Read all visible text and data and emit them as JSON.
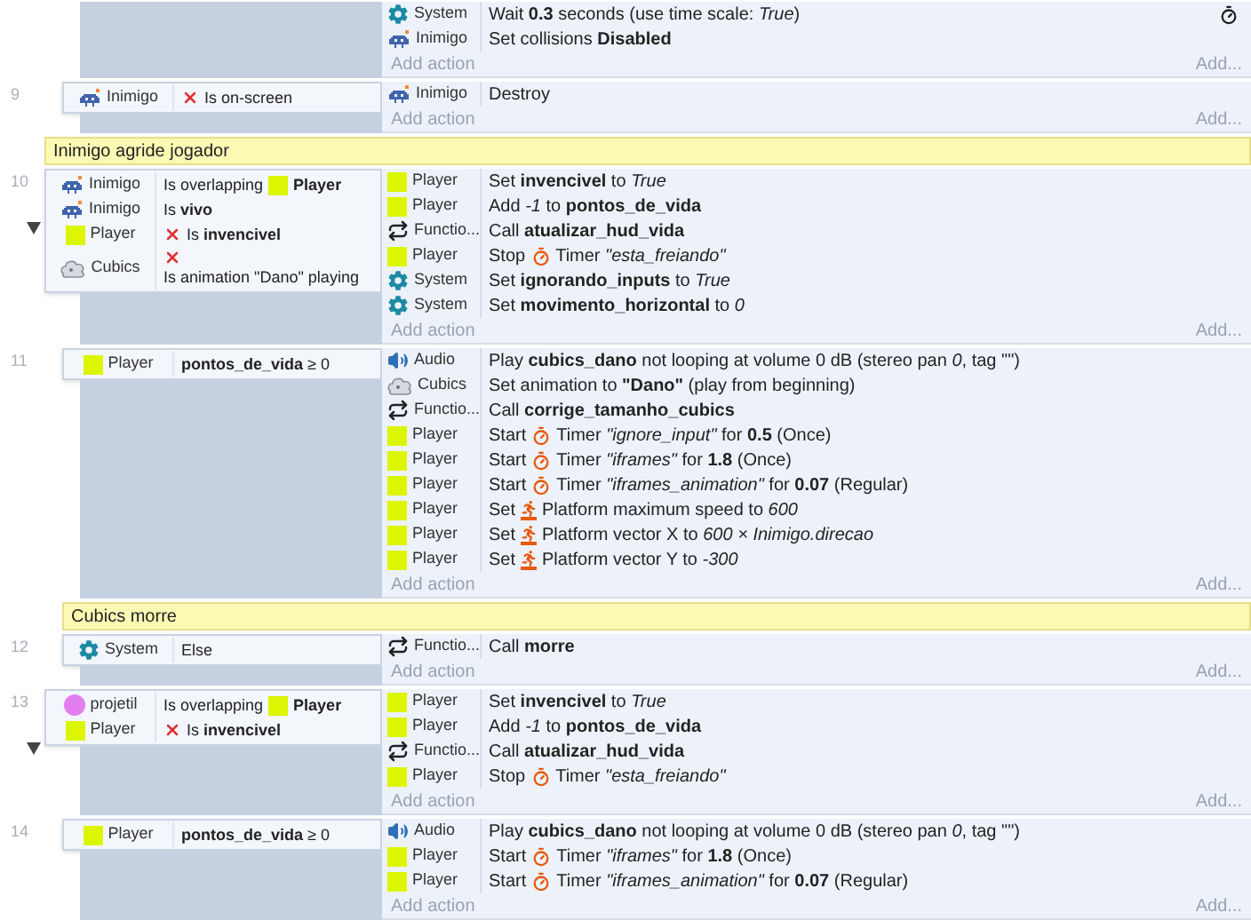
{
  "events": [
    {
      "kind": "event",
      "children": [
        {
          "kind": "event",
          "timer": true,
          "actions": [
            {
              "kind": "plain",
              "object": {
                "name": "System",
                "kind": "system"
              },
              "text": "Wait **0.3** seconds (use time scale: *True*)"
            },
            {
              "kind": "plain",
              "object": {
                "name": "Inimigo",
                "kind": "enemy"
              },
              "text": "Set collisions **Disabled**"
            }
          ],
          "add_action": "Add action",
          "add": "Add..."
        },
        {
          "kind": "event",
          "number": "9",
          "conditions": [
            {
              "object": {
                "name": "Inimigo",
                "kind": "enemy"
              },
              "inverted": true,
              "text": "Is on-screen"
            }
          ],
          "actions": [
            {
              "kind": "plain",
              "object": {
                "name": "Inimigo",
                "kind": "enemy"
              },
              "text": "Destroy"
            }
          ],
          "add_action": "Add action",
          "add": "Add..."
        }
      ]
    },
    {
      "kind": "comment",
      "text": "Inimigo agride jogador"
    },
    {
      "kind": "event",
      "number": "10",
      "expanded": true,
      "conditions": [
        {
          "object": {
            "name": "Inimigo",
            "kind": "enemy"
          },
          "inverted": false,
          "text": "Is overlapping",
          "target": {
            "name": "Player",
            "kind": "sprite"
          }
        },
        {
          "object": {
            "name": "Inimigo",
            "kind": "enemy"
          },
          "inverted": false,
          "text": "Is **vivo**"
        },
        {
          "object": {
            "name": "Player",
            "kind": "sprite"
          },
          "inverted": true,
          "text": "Is **invencivel**"
        },
        {
          "object": {
            "name": "Cubics",
            "kind": "cubics"
          },
          "inverted": true,
          "text": "Is animation \"Dano\" playing"
        }
      ],
      "actions": [
        {
          "kind": "plain",
          "object": {
            "name": "Player",
            "kind": "sprite"
          },
          "text": "Set **invencivel** to *True*"
        },
        {
          "kind": "plain",
          "object": {
            "name": "Player",
            "kind": "sprite"
          },
          "text": "Add *-1* to **pontos_de_vida**"
        },
        {
          "kind": "plain",
          "object": {
            "name": "Functio...",
            "kind": "function"
          },
          "text": "Call **atualizar_hud_vida**"
        },
        {
          "kind": "timer",
          "object": {
            "name": "Player",
            "kind": "sprite"
          },
          "verb": "Stop",
          "text": "Timer *\"esta_freiando\"*"
        },
        {
          "kind": "plain",
          "object": {
            "name": "System",
            "kind": "system"
          },
          "text": "Set **ignorando_inputs** to *True*"
        },
        {
          "kind": "plain",
          "object": {
            "name": "System",
            "kind": "system"
          },
          "text": "Set **movimento_horizontal** to *0*"
        }
      ],
      "add_action": "Add action",
      "add": "Add...",
      "children": [
        {
          "kind": "event",
          "number": "11",
          "conditions": [
            {
              "object": {
                "name": "Player",
                "kind": "sprite"
              },
              "inverted": false,
              "text": "**pontos_de_vida** ≥ 0"
            }
          ],
          "actions": [
            {
              "kind": "plain",
              "object": {
                "name": "Audio",
                "kind": "audio"
              },
              "text": "Play **cubics_dano** not looping at volume 0 dB (stereo pan *0*, tag \"\")"
            },
            {
              "kind": "plain",
              "object": {
                "name": "Cubics",
                "kind": "cubics"
              },
              "text": "Set animation to **\"Dano\"** (play from beginning)"
            },
            {
              "kind": "plain",
              "object": {
                "name": "Functio...",
                "kind": "function"
              },
              "text": "Call **corrige_tamanho_cubics**"
            },
            {
              "kind": "timer",
              "object": {
                "name": "Player",
                "kind": "sprite"
              },
              "verb": "Start",
              "text": "Timer *\"ignore_input\"* for **0.5** (Once)"
            },
            {
              "kind": "timer",
              "object": {
                "name": "Player",
                "kind": "sprite"
              },
              "verb": "Start",
              "text": "Timer *\"iframes\"* for **1.8** (Once)"
            },
            {
              "kind": "timer",
              "object": {
                "name": "Player",
                "kind": "sprite"
              },
              "verb": "Start",
              "text": "Timer *\"iframes_animation\"* for **0.07** (Regular)"
            },
            {
              "kind": "platform",
              "object": {
                "name": "Player",
                "kind": "sprite"
              },
              "verb": "Set",
              "text": "Platform maximum speed to *600*"
            },
            {
              "kind": "platform",
              "object": {
                "name": "Player",
                "kind": "sprite"
              },
              "verb": "Set",
              "text": "Platform vector X to *600 × Inimigo.direcao*"
            },
            {
              "kind": "platform",
              "object": {
                "name": "Player",
                "kind": "sprite"
              },
              "verb": "Set",
              "text": "Platform vector Y to *-300*"
            }
          ],
          "add_action": "Add action",
          "add": "Add..."
        },
        {
          "kind": "comment",
          "text": "Cubics morre"
        },
        {
          "kind": "event",
          "number": "12",
          "conditions": [
            {
              "object": {
                "name": "System",
                "kind": "system"
              },
              "inverted": false,
              "text": "Else"
            }
          ],
          "actions": [
            {
              "kind": "plain",
              "object": {
                "name": "Functio...",
                "kind": "function"
              },
              "text": "Call **morre**"
            }
          ],
          "add_action": "Add action",
          "add": "Add..."
        }
      ]
    },
    {
      "kind": "event",
      "number": "13",
      "expanded": true,
      "conditions": [
        {
          "object": {
            "name": "projetil",
            "kind": "projectile"
          },
          "inverted": false,
          "text": "Is overlapping",
          "target": {
            "name": "Player",
            "kind": "sprite"
          }
        },
        {
          "object": {
            "name": "Player",
            "kind": "sprite"
          },
          "inverted": true,
          "text": "Is **invencivel**"
        }
      ],
      "actions": [
        {
          "kind": "plain",
          "object": {
            "name": "Player",
            "kind": "sprite"
          },
          "text": "Set **invencivel** to *True*"
        },
        {
          "kind": "plain",
          "object": {
            "name": "Player",
            "kind": "sprite"
          },
          "text": "Add *-1* to **pontos_de_vida**"
        },
        {
          "kind": "plain",
          "object": {
            "name": "Functio...",
            "kind": "function"
          },
          "text": "Call **atualizar_hud_vida**"
        },
        {
          "kind": "timer",
          "object": {
            "name": "Player",
            "kind": "sprite"
          },
          "verb": "Stop",
          "text": "Timer *\"esta_freiando\"*"
        }
      ],
      "add_action": "Add action",
      "add": "Add...",
      "children": [
        {
          "kind": "event",
          "number": "14",
          "conditions": [
            {
              "object": {
                "name": "Player",
                "kind": "sprite"
              },
              "inverted": false,
              "text": "**pontos_de_vida** ≥ 0"
            }
          ],
          "actions": [
            {
              "kind": "plain",
              "object": {
                "name": "Audio",
                "kind": "audio"
              },
              "text": "Play **cubics_dano** not looping at volume 0 dB (stereo pan *0*, tag \"\")"
            },
            {
              "kind": "timer",
              "object": {
                "name": "Player",
                "kind": "sprite"
              },
              "verb": "Start",
              "text": "Timer *\"iframes\"* for **1.8** (Once)"
            },
            {
              "kind": "timer",
              "object": {
                "name": "Player",
                "kind": "sprite"
              },
              "verb": "Start",
              "text": "Timer *\"iframes_animation\"* for **0.07** (Regular)"
            }
          ],
          "add_action": "Add action",
          "add": "Add..."
        }
      ]
    }
  ]
}
